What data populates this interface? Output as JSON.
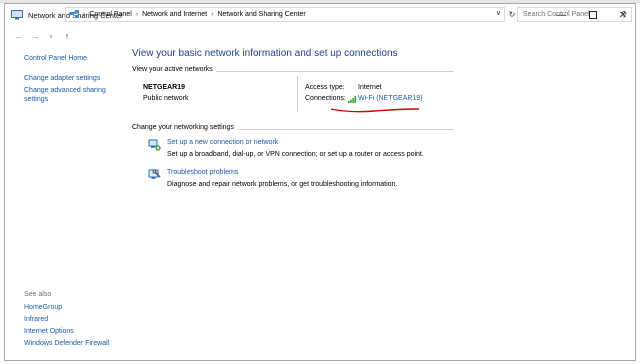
{
  "window": {
    "title": "Network and Sharing Center",
    "minimize_icon": "minimize-icon",
    "maximize_icon": "maximize-icon",
    "close_icon": "close-icon"
  },
  "address_bar": {
    "breadcrumbs": [
      "Control Panel",
      "Network and Internet",
      "Network and Sharing Center"
    ],
    "search_placeholder": "Search Control Panel"
  },
  "left_pane": {
    "home": "Control Panel Home",
    "links": [
      "Change adapter settings",
      "Change advanced sharing settings"
    ],
    "see_also_header": "See also",
    "see_also": [
      "HomeGroup",
      "Infrared",
      "Internet Options",
      "Windows Defender Firewall"
    ]
  },
  "main": {
    "heading": "View your basic network information and set up connections",
    "active_networks_title": "View your active networks",
    "network": {
      "name": "NETGEAR19",
      "category": "Public network",
      "access_type_label": "Access type:",
      "access_type_value": "Internet",
      "connections_label": "Connections:",
      "connection_value": "Wi-Fi (NETGEAR19)"
    },
    "settings_title": "Change your networking settings",
    "tasks": [
      {
        "link": "Set up a new connection or network",
        "desc": "Set up a broadband, dial-up, or VPN connection; or set up a router or access point."
      },
      {
        "link": "Troubleshoot problems",
        "desc": "Diagnose and repair network problems, or get troubleshooting information."
      }
    ]
  },
  "colors": {
    "link": "#1a5aa8",
    "heading": "#1e3f8a",
    "annotation_underline": "#d40000"
  }
}
